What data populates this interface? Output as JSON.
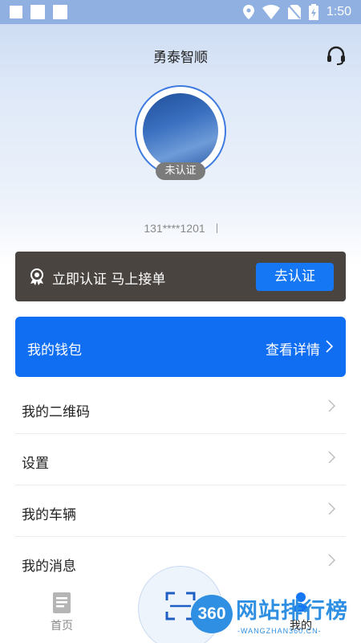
{
  "status_bar": {
    "time": "1:50"
  },
  "header": {
    "title": "勇泰智顺",
    "support_icon": "headset-icon"
  },
  "profile": {
    "badge": "未认证",
    "phone": "131****1201"
  },
  "certify_banner": {
    "text": "立即认证 马上接单",
    "button": "去认证",
    "icon": "award-icon"
  },
  "wallet": {
    "label": "我的钱包",
    "detail": "查看详情"
  },
  "menu": [
    {
      "label": "我的二维码"
    },
    {
      "label": "设置"
    },
    {
      "label": "我的车辆"
    },
    {
      "label": "我的消息"
    }
  ],
  "bottom_nav": {
    "home": "首页",
    "mine": "我的"
  },
  "watermark": {
    "logo": "360",
    "title": "网站排行榜",
    "sub": "-WANGZHAN360.CN-"
  },
  "colors": {
    "primary": "#0f6ef2",
    "banner_bg": "#4a4440"
  }
}
